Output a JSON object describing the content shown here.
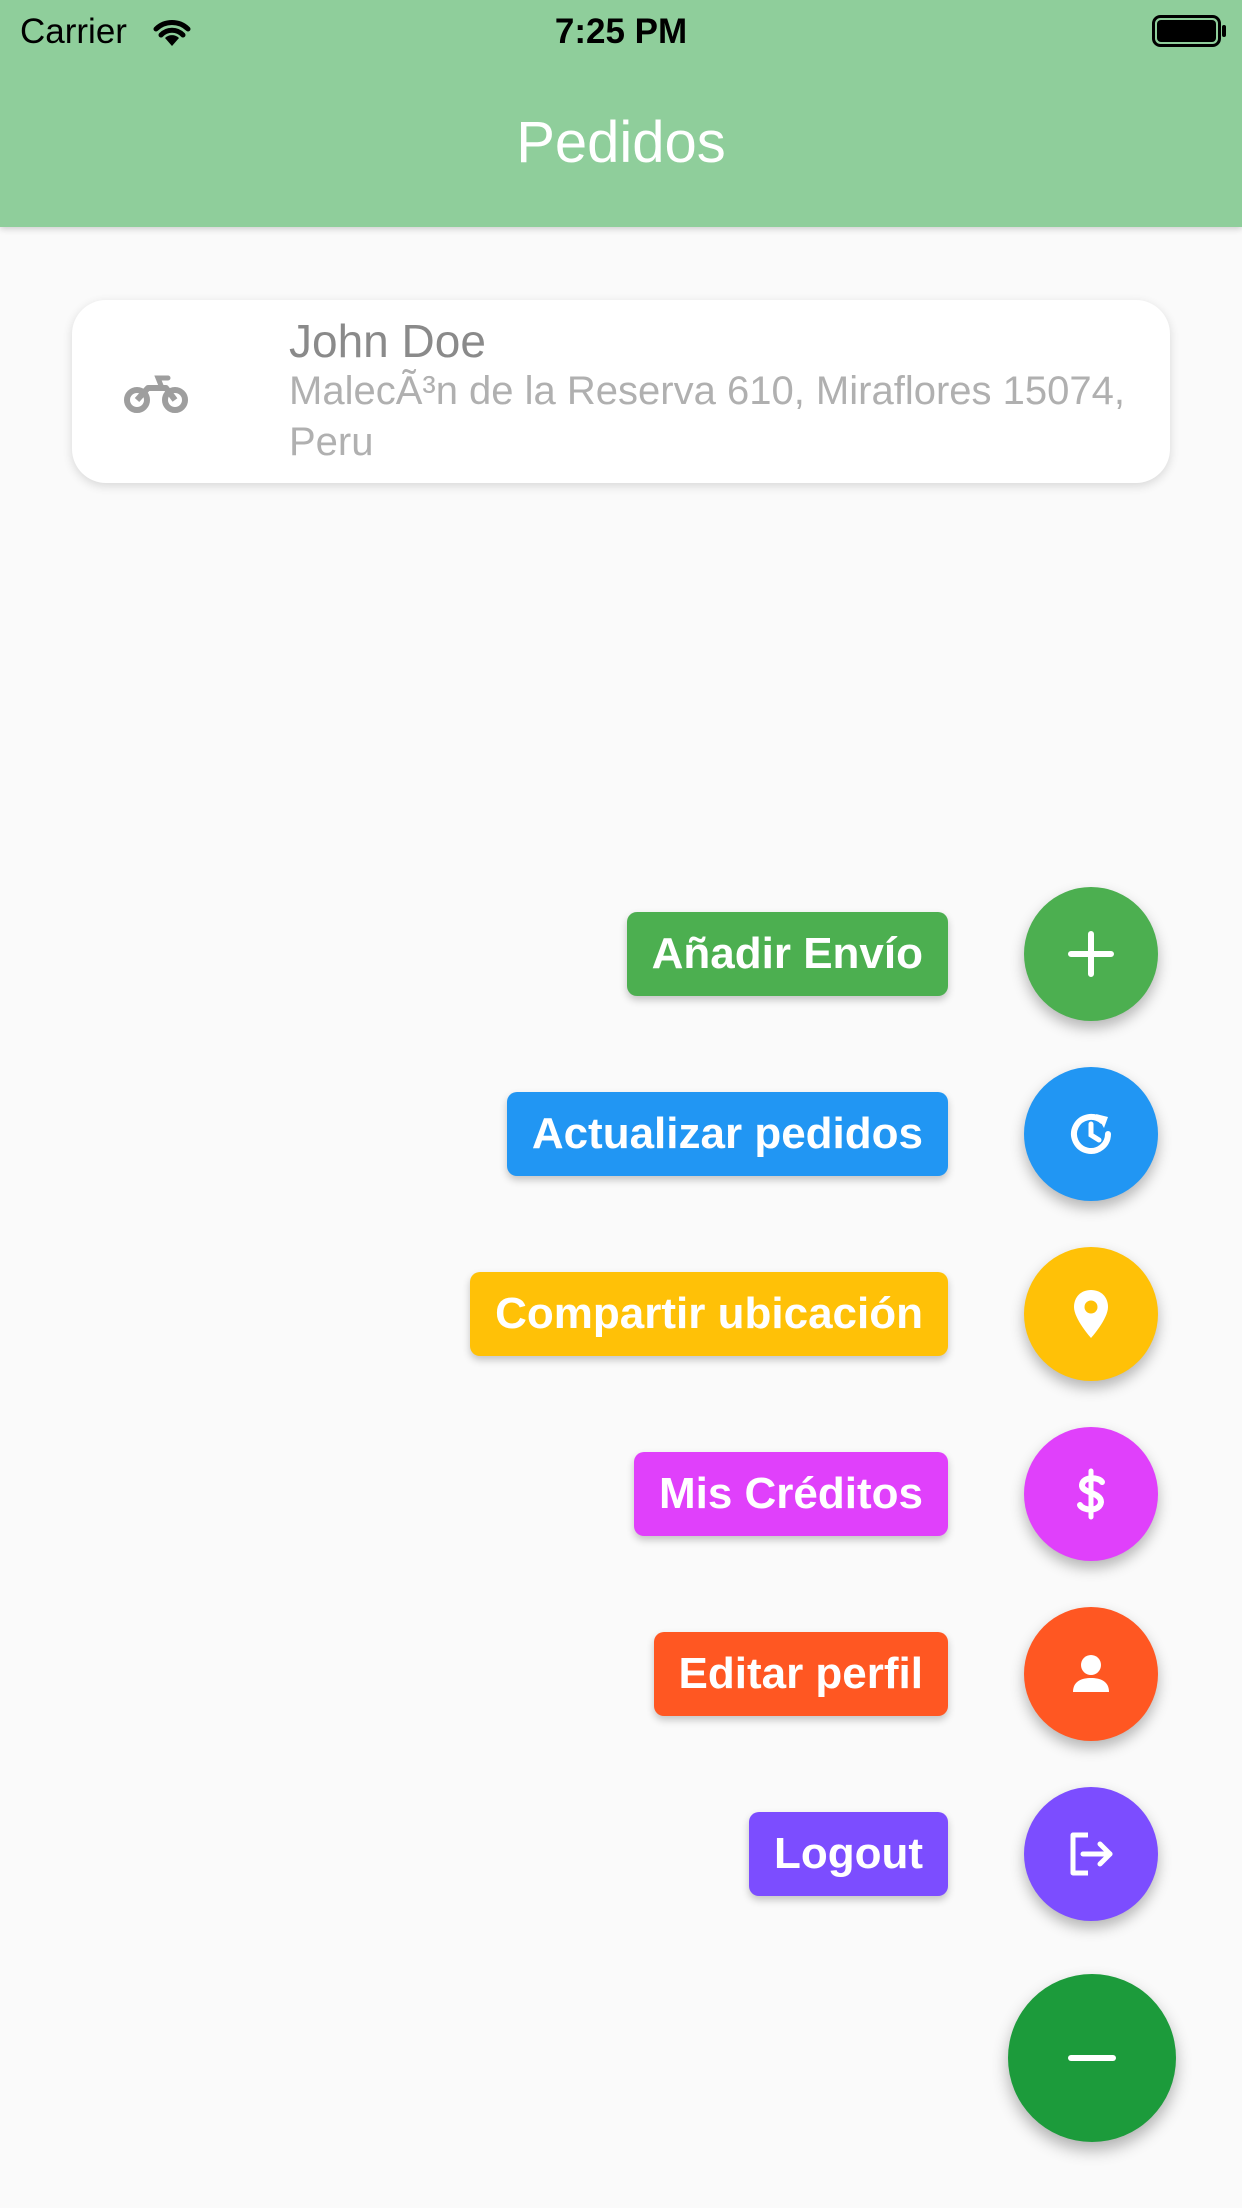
{
  "status_bar": {
    "carrier": "Carrier",
    "time": "7:25 PM"
  },
  "header": {
    "title": "Pedidos",
    "background_color": "#8fce9b"
  },
  "orders": [
    {
      "icon": "motorcycle-icon",
      "name": "John Doe",
      "address": "MalecÃ³n de la Reserva 610, Miraflores 15074, Peru"
    }
  ],
  "actions": [
    {
      "label": "Añadir Envío",
      "icon": "plus-icon",
      "color": "#4caf50"
    },
    {
      "label": "Actualizar pedidos",
      "icon": "update-clock-icon",
      "color": "#2196f3"
    },
    {
      "label": "Compartir ubicación",
      "icon": "location-pin-icon",
      "color": "#ffc107"
    },
    {
      "label": "Mis Créditos",
      "icon": "dollar-icon",
      "color": "#e040fb"
    },
    {
      "label": "Editar perfil",
      "icon": "person-icon",
      "color": "#ff5722"
    },
    {
      "label": "Logout",
      "icon": "logout-icon",
      "color": "#7c4dff"
    }
  ],
  "main_fab": {
    "icon": "minus-icon",
    "color": "#1c9b3b"
  }
}
